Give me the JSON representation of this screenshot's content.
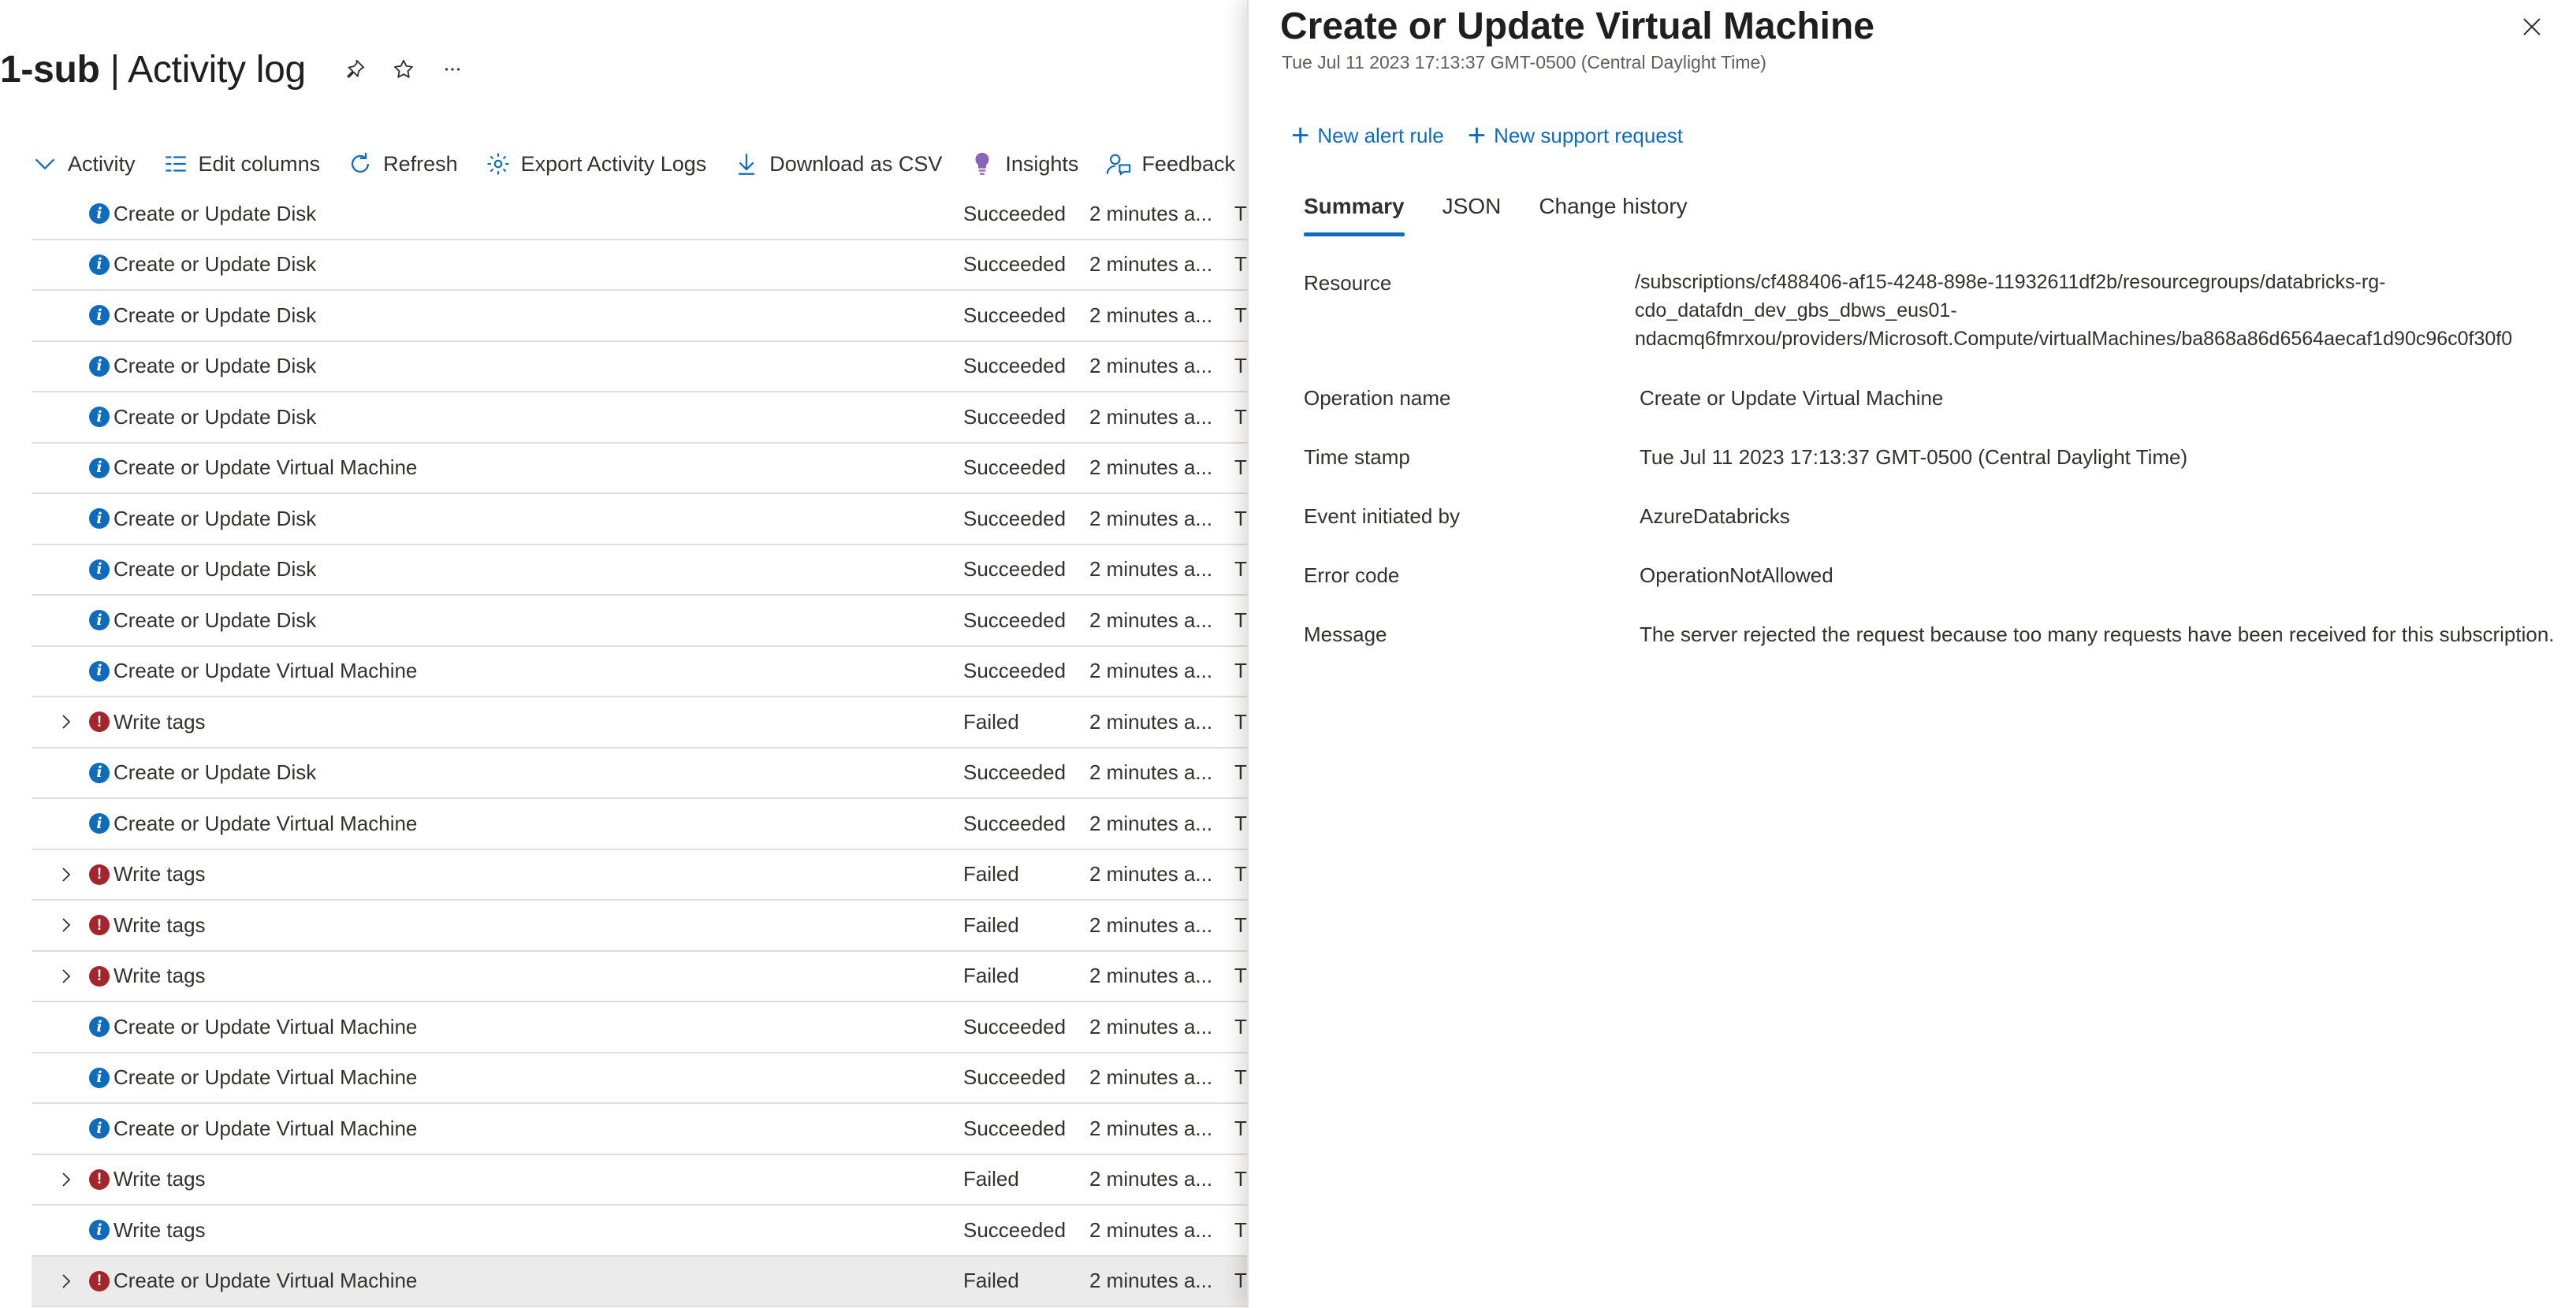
{
  "page": {
    "title_bold": "1-sub",
    "title_rest": " | Activity log"
  },
  "header_icons": [
    "pin-icon",
    "star-icon",
    "more-icon"
  ],
  "toolbar": {
    "activity": "Activity",
    "edit_columns": "Edit columns",
    "refresh": "Refresh",
    "export": "Export Activity Logs",
    "download_csv": "Download as CSV",
    "insights": "Insights",
    "feedback": "Feedback"
  },
  "rows": [
    {
      "op": "Create or Update Disk",
      "status": "Succeeded",
      "time": "2 minutes a...",
      "ts": "Tu",
      "level": "info",
      "expandable": false
    },
    {
      "op": "Create or Update Disk",
      "status": "Succeeded",
      "time": "2 minutes a...",
      "ts": "Tu",
      "level": "info",
      "expandable": false
    },
    {
      "op": "Create or Update Disk",
      "status": "Succeeded",
      "time": "2 minutes a...",
      "ts": "Tu",
      "level": "info",
      "expandable": false
    },
    {
      "op": "Create or Update Disk",
      "status": "Succeeded",
      "time": "2 minutes a...",
      "ts": "Tu",
      "level": "info",
      "expandable": false
    },
    {
      "op": "Create or Update Disk",
      "status": "Succeeded",
      "time": "2 minutes a...",
      "ts": "Tu",
      "level": "info",
      "expandable": false
    },
    {
      "op": "Create or Update Virtual Machine",
      "status": "Succeeded",
      "time": "2 minutes a...",
      "ts": "Tu",
      "level": "info",
      "expandable": false
    },
    {
      "op": "Create or Update Disk",
      "status": "Succeeded",
      "time": "2 minutes a...",
      "ts": "Tu",
      "level": "info",
      "expandable": false
    },
    {
      "op": "Create or Update Disk",
      "status": "Succeeded",
      "time": "2 minutes a...",
      "ts": "Tu",
      "level": "info",
      "expandable": false
    },
    {
      "op": "Create or Update Disk",
      "status": "Succeeded",
      "time": "2 minutes a...",
      "ts": "Tu",
      "level": "info",
      "expandable": false
    },
    {
      "op": "Create or Update Virtual Machine",
      "status": "Succeeded",
      "time": "2 minutes a...",
      "ts": "Tu",
      "level": "info",
      "expandable": false
    },
    {
      "op": "Write tags",
      "status": "Failed",
      "time": "2 minutes a...",
      "ts": "Tu",
      "level": "error",
      "expandable": true
    },
    {
      "op": "Create or Update Disk",
      "status": "Succeeded",
      "time": "2 minutes a...",
      "ts": "Tu",
      "level": "info",
      "expandable": false
    },
    {
      "op": "Create or Update Virtual Machine",
      "status": "Succeeded",
      "time": "2 minutes a...",
      "ts": "Tu",
      "level": "info",
      "expandable": false
    },
    {
      "op": "Write tags",
      "status": "Failed",
      "time": "2 minutes a...",
      "ts": "Tu",
      "level": "error",
      "expandable": true
    },
    {
      "op": "Write tags",
      "status": "Failed",
      "time": "2 minutes a...",
      "ts": "Tu",
      "level": "error",
      "expandable": true
    },
    {
      "op": "Write tags",
      "status": "Failed",
      "time": "2 minutes a...",
      "ts": "Tu",
      "level": "error",
      "expandable": true
    },
    {
      "op": "Create or Update Virtual Machine",
      "status": "Succeeded",
      "time": "2 minutes a...",
      "ts": "Tu",
      "level": "info",
      "expandable": false
    },
    {
      "op": "Create or Update Virtual Machine",
      "status": "Succeeded",
      "time": "2 minutes a...",
      "ts": "Tu",
      "level": "info",
      "expandable": false
    },
    {
      "op": "Create or Update Virtual Machine",
      "status": "Succeeded",
      "time": "2 minutes a...",
      "ts": "Tu",
      "level": "info",
      "expandable": false
    },
    {
      "op": "Write tags",
      "status": "Failed",
      "time": "2 minutes a...",
      "ts": "Tu",
      "level": "error",
      "expandable": true
    },
    {
      "op": "Write tags",
      "status": "Succeeded",
      "time": "2 minutes a...",
      "ts": "Tu",
      "level": "info",
      "expandable": false
    },
    {
      "op": "Create or Update Virtual Machine",
      "status": "Failed",
      "time": "2 minutes a...",
      "ts": "Tu",
      "level": "error",
      "expandable": true,
      "selected": true
    }
  ],
  "panel": {
    "title": "Create or Update Virtual Machine",
    "subtitle": "Tue Jul 11 2023 17:13:37 GMT-0500 (Central Daylight Time)",
    "actions": {
      "new_alert_rule": "New alert rule",
      "new_support_request": "New support request"
    },
    "tabs": [
      "Summary",
      "JSON",
      "Change history"
    ],
    "active_tab": 0,
    "fields": {
      "resource_label": "Resource",
      "resource_lines": [
        "/subscriptions/cf488406-af15-4248-898e-11932611df2b/resourcegroups/databricks-rg-",
        "cdo_datafdn_dev_gbs_dbws_eus01-",
        "ndacmq6fmrxou/providers/Microsoft.Compute/virtualMachines/ba868a86d6564aecaf1d90c96c0f30f0"
      ],
      "operation_name_label": "Operation name",
      "operation_name": "Create or Update Virtual Machine",
      "time_stamp_label": "Time stamp",
      "time_stamp": "Tue Jul 11 2023 17:13:37 GMT-0500 (Central Daylight Time)",
      "initiated_by_label": "Event initiated by",
      "initiated_by": "AzureDatabricks",
      "error_code_label": "Error code",
      "error_code": "OperationNotAllowed",
      "message_label": "Message",
      "message": "The server rejected the request because too many requests have been received for this subscription."
    }
  },
  "colors": {
    "accent": "#0f6cbd",
    "error": "#a4262c",
    "info": "#0f6cbd",
    "selected_row": "#ebebeb",
    "divider": "#e1dfdd"
  }
}
